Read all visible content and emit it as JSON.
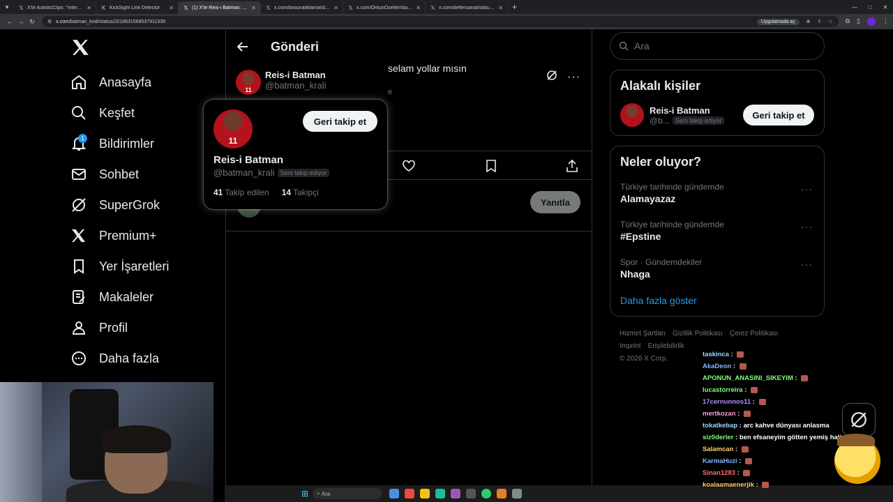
{
  "browser": {
    "tabs": [
      {
        "label": "X'te AutisticClips: \"Interviewer:",
        "active": false,
        "icon": "x-favicon"
      },
      {
        "label": "KickSight Link Detector",
        "active": false,
        "icon": "kick-favicon"
      },
      {
        "label": "(1) X'te Reis-i Batman: \"abi \"ba",
        "active": true,
        "icon": "x-favicon"
      },
      {
        "label": "x.com/bosunatiklama/status/2",
        "active": false,
        "icon": "x-favicon"
      },
      {
        "label": "x.com/OrkunOzeller/status/20",
        "active": false,
        "icon": "x-favicon"
      },
      {
        "label": "x.com/deftersanat/status/2018",
        "active": false,
        "icon": "x-favicon"
      }
    ],
    "url_host": "x.com",
    "url_path": "/batman_krali/status/2018631568537911339",
    "open_in_app": "Uygulamada aç"
  },
  "nav": {
    "items": [
      {
        "label": "Anasayfa",
        "icon": "home-icon"
      },
      {
        "label": "Keşfet",
        "icon": "search-icon"
      },
      {
        "label": "Bildirimler",
        "icon": "bell-icon",
        "badge": "1"
      },
      {
        "label": "Sohbet",
        "icon": "mail-icon"
      },
      {
        "label": "SuperGrok",
        "icon": "grok-icon"
      },
      {
        "label": "Premium+",
        "icon": "x-icon"
      },
      {
        "label": "Yer İşaretleri",
        "icon": "bookmark-icon"
      },
      {
        "label": "Makaleler",
        "icon": "article-icon"
      },
      {
        "label": "Profil",
        "icon": "person-icon"
      },
      {
        "label": "Daha fazla",
        "icon": "more-circle-icon"
      }
    ]
  },
  "main": {
    "title": "Gönderi",
    "post": {
      "author_name": "Reis-i Batman",
      "author_handle": "@batman_krali",
      "text_visible": "selam yollar mısın",
      "meta_visible": "e",
      "jersey": "11"
    },
    "reply_button": "Yanıtla"
  },
  "hovercard": {
    "name": "Reis-i Batman",
    "handle": "@batman_krali",
    "follows_you": "Seni takip ediyor",
    "follow_button": "Geri takip et",
    "following_count": "41",
    "following_label": "Takip edilen",
    "followers_count": "14",
    "followers_label": "Takipçi",
    "jersey": "11"
  },
  "right": {
    "search_placeholder": "Ara",
    "related": {
      "title": "Alakalı kişiler",
      "name": "Reis-i Batman",
      "handle": "@b...",
      "follows_you": "Seni takip ediyor",
      "button": "Geri takip et"
    },
    "trends": {
      "title": "Neler oluyor?",
      "items": [
        {
          "category": "Türkiye tarihinde gündemde",
          "title": "Alamayazaz"
        },
        {
          "category": "Türkiye tarihinde gündemde",
          "title": "#Epstine"
        },
        {
          "category": "Spor · Gündemdekiler",
          "title": "Nhaga"
        }
      ],
      "show_more": "Daha fazla göster"
    },
    "footer": {
      "links": [
        "Hizmet Şartları",
        "Gizlilik Politikası",
        "Çerez Politikası",
        "Imprint",
        "Erişilebilirlik"
      ],
      "copyright": "© 2026 X Corp."
    }
  },
  "chat": [
    {
      "user": "taskinca",
      "msg": "",
      "color": "#9ad7ff"
    },
    {
      "user": "AkaDeon",
      "msg": "",
      "color": "#7fb7ff"
    },
    {
      "user": "APONUN_ANASINI_SIKEYIM",
      "msg": "",
      "color": "#7dff7d"
    },
    {
      "user": "lucastorreira",
      "msg": "",
      "color": "#7dff7d"
    },
    {
      "user": "17cernunnos11",
      "msg": "",
      "color": "#b58cff"
    },
    {
      "user": "mertkozan",
      "msg": "",
      "color": "#ff9dd6"
    },
    {
      "user": "tokatkebap",
      "msg": "arc kahve dünyası anlasma",
      "color": "#9ad7ff"
    },
    {
      "user": "siz0derler",
      "msg": "ben efsaneyim götten yemiş hali",
      "color": "#7dff7d"
    },
    {
      "user": "Salamcan",
      "msg": "",
      "color": "#ffd166"
    },
    {
      "user": "KarmaHuzi",
      "msg": "",
      "color": "#7fb7ff"
    },
    {
      "user": "Sinan1283",
      "msg": "",
      "color": "#ff6b6b"
    },
    {
      "user": "koalaamaenerjik",
      "msg": "",
      "color": "#ffd166"
    }
  ],
  "taskbar": {
    "search_placeholder": "Ara"
  }
}
